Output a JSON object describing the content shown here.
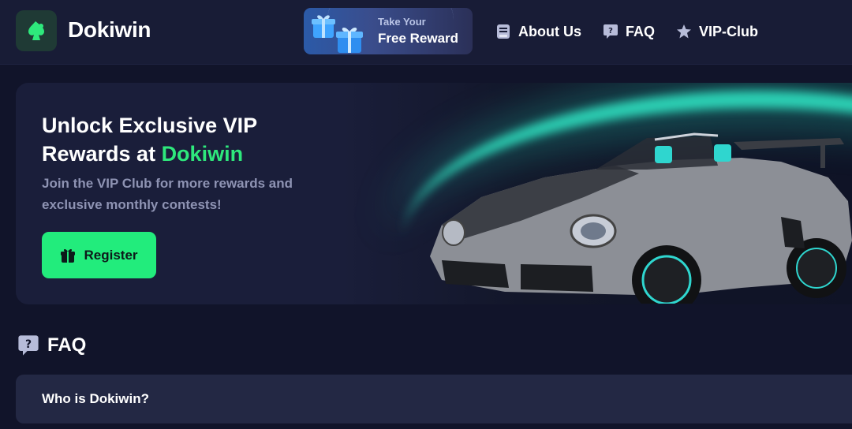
{
  "header": {
    "brand": "Dokiwin",
    "reward": {
      "top": "Take Your",
      "bottom": "Free Reward"
    },
    "nav": [
      {
        "label": "About Us",
        "icon": "book-icon"
      },
      {
        "label": "FAQ",
        "icon": "question-bubble-icon"
      },
      {
        "label": "VIP-Club",
        "icon": "star-icon"
      }
    ]
  },
  "hero": {
    "title_line1": "Unlock Exclusive VIP",
    "title_line2_prefix": "Rewards at ",
    "title_line2_accent": "Dokiwin",
    "subtitle": "Join the VIP Club for more rewards and exclusive monthly contests!",
    "register_label": "Register"
  },
  "faq": {
    "heading": "FAQ",
    "items": [
      {
        "question": "Who is Dokiwin?"
      }
    ]
  },
  "colors": {
    "background": "#11142a",
    "header": "#181c36",
    "accent_green": "#22ec7c",
    "teal_glow": "#2fe0c0",
    "muted_text": "#8e93b3"
  }
}
